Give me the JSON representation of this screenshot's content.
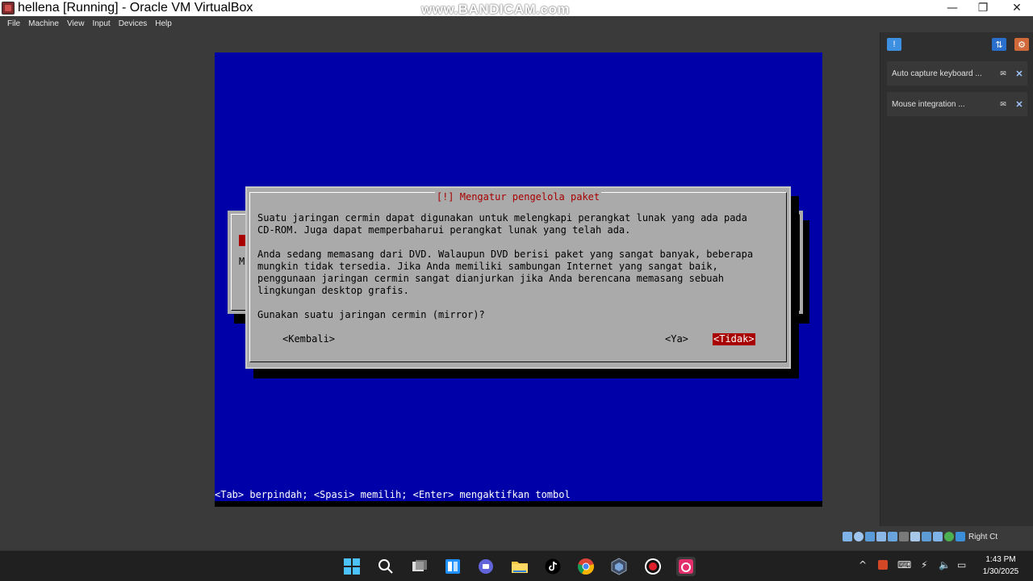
{
  "window": {
    "title": "hellena [Running] - Oracle VM VirtualBox",
    "watermark": "www.BANDICAM.com",
    "minimize": "—",
    "maximize": "❐",
    "close": "✕"
  },
  "menu": [
    "File",
    "Machine",
    "View",
    "Input",
    "Devices",
    "Help"
  ],
  "side_panel": {
    "notifications": [
      {
        "text": "Auto capture keyboard ..."
      },
      {
        "text": "Mouse integration ..."
      }
    ]
  },
  "status_bar": {
    "host_key": "Right Ct"
  },
  "vm": {
    "dialog": {
      "title": "[!] Mengatur pengelola paket",
      "paragraphs": [
        "Suatu jaringan cermin dapat digunakan untuk melengkapi perangkat lunak yang ada pada\nCD-ROM. Juga dapat memperbaharui perangkat lunak yang telah ada.",
        "Anda sedang memasang dari DVD. Walaupun DVD berisi paket yang sangat banyak, beberapa\nmungkin tidak tersedia. Jika Anda memiliki sambungan Internet yang sangat baik,\npenggunaan jaringan cermin sangat dianjurkan jika Anda berencana memasang sebuah\nlingkungan desktop grafis.",
        "Gunakan suatu jaringan cermin (mirror)?"
      ],
      "buttons": {
        "back": "<Kembali>",
        "yes": "<Ya>",
        "no": "<Tidak>"
      }
    },
    "background_dialog_letter": "M",
    "help_line": "<Tab> berpindah; <Spasi> memilih; <Enter> mengaktifkan tombol"
  },
  "taskbar": {
    "time": "1:43 PM",
    "date": "1/30/2025"
  },
  "colors": {
    "vm_background": "#0000a8",
    "dialog_gray": "#aaaaaa",
    "accent_red": "#a80000"
  }
}
